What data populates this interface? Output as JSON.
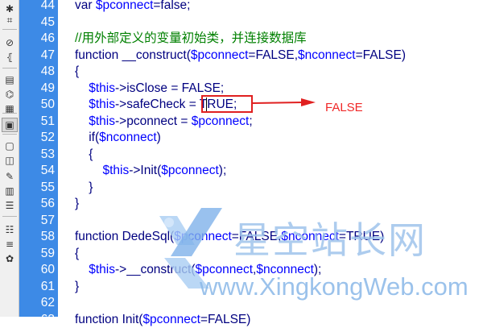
{
  "toolbar": {
    "icons": [
      "asterisk-icon",
      "hash-icon",
      "no-entry-icon",
      "braces-icon",
      "format-icon",
      "tag-icon",
      "snippet-icon",
      "preview-icon",
      "comment-icon",
      "chat-icon",
      "edit-icon",
      "book-icon",
      "outdent-icon",
      "indent-icon",
      "fold-icon",
      "help-icon"
    ]
  },
  "editor": {
    "lines": [
      {
        "n": "44",
        "segs": [
          {
            "t": "var ",
            "c": "plain"
          },
          {
            "t": "$pconnect",
            "c": "var"
          },
          {
            "t": "=false;",
            "c": "plain"
          }
        ]
      },
      {
        "n": "45",
        "segs": []
      },
      {
        "n": "46",
        "segs": [
          {
            "t": "//用外部定义的变量初始类，并连接数据库",
            "c": "cmt"
          }
        ]
      },
      {
        "n": "47",
        "segs": [
          {
            "t": "function __construct(",
            "c": "plain"
          },
          {
            "t": "$pconnect",
            "c": "var"
          },
          {
            "t": "=FALSE,",
            "c": "plain"
          },
          {
            "t": "$nconnect",
            "c": "var"
          },
          {
            "t": "=FALSE)",
            "c": "plain"
          }
        ]
      },
      {
        "n": "48",
        "segs": [
          {
            "t": "{",
            "c": "plain"
          }
        ]
      },
      {
        "n": "49",
        "segs": [
          {
            "t": "    ",
            "c": "plain"
          },
          {
            "t": "$this",
            "c": "var"
          },
          {
            "t": "->isClose = FALSE;",
            "c": "plain"
          }
        ]
      },
      {
        "n": "50",
        "segs": [
          {
            "t": "    ",
            "c": "plain"
          },
          {
            "t": "$this",
            "c": "var"
          },
          {
            "t": "->safeCheck = TRUE;",
            "c": "plain"
          }
        ]
      },
      {
        "n": "51",
        "segs": [
          {
            "t": "    ",
            "c": "plain"
          },
          {
            "t": "$this",
            "c": "var"
          },
          {
            "t": "->pconnect = ",
            "c": "plain"
          },
          {
            "t": "$pconnect",
            "c": "var"
          },
          {
            "t": ";",
            "c": "plain"
          }
        ]
      },
      {
        "n": "52",
        "segs": [
          {
            "t": "    if(",
            "c": "plain"
          },
          {
            "t": "$nconnect",
            "c": "var"
          },
          {
            "t": ")",
            "c": "plain"
          }
        ]
      },
      {
        "n": "53",
        "segs": [
          {
            "t": "    {",
            "c": "plain"
          }
        ]
      },
      {
        "n": "54",
        "segs": [
          {
            "t": "        ",
            "c": "plain"
          },
          {
            "t": "$this",
            "c": "var"
          },
          {
            "t": "->Init(",
            "c": "plain"
          },
          {
            "t": "$pconnect",
            "c": "var"
          },
          {
            "t": ");",
            "c": "plain"
          }
        ]
      },
      {
        "n": "55",
        "segs": [
          {
            "t": "    }",
            "c": "plain"
          }
        ]
      },
      {
        "n": "56",
        "segs": [
          {
            "t": "}",
            "c": "plain"
          }
        ]
      },
      {
        "n": "57",
        "segs": []
      },
      {
        "n": "58",
        "segs": [
          {
            "t": "function DedeSql(",
            "c": "plain"
          },
          {
            "t": "$pconnect",
            "c": "var"
          },
          {
            "t": "=FALSE,",
            "c": "plain"
          },
          {
            "t": "$nconnect",
            "c": "var"
          },
          {
            "t": "=TRUE)",
            "c": "plain"
          }
        ]
      },
      {
        "n": "59",
        "segs": [
          {
            "t": "{",
            "c": "plain"
          }
        ]
      },
      {
        "n": "60",
        "segs": [
          {
            "t": "    ",
            "c": "plain"
          },
          {
            "t": "$this",
            "c": "var"
          },
          {
            "t": "->__construct(",
            "c": "plain"
          },
          {
            "t": "$pconnect",
            "c": "var"
          },
          {
            "t": ",",
            "c": "plain"
          },
          {
            "t": "$nconnect",
            "c": "var"
          },
          {
            "t": ");",
            "c": "plain"
          }
        ]
      },
      {
        "n": "61",
        "segs": [
          {
            "t": "}",
            "c": "plain"
          }
        ]
      },
      {
        "n": "62",
        "segs": []
      },
      {
        "n": "63",
        "segs": [
          {
            "t": "function Init(",
            "c": "plain"
          },
          {
            "t": "$pconnect",
            "c": "var"
          },
          {
            "t": "=FALSE)",
            "c": "plain"
          }
        ]
      }
    ]
  },
  "annotation": {
    "label": "FALSE",
    "color": "#f02828"
  },
  "watermark": {
    "cn": "星空站长网",
    "en": "www.XingkongWeb.com"
  },
  "colors": {
    "gutter": "#3d8ae6",
    "keyword": "#000080",
    "variable": "#0000ff",
    "comment": "#008000",
    "highlight": "#e02020"
  }
}
